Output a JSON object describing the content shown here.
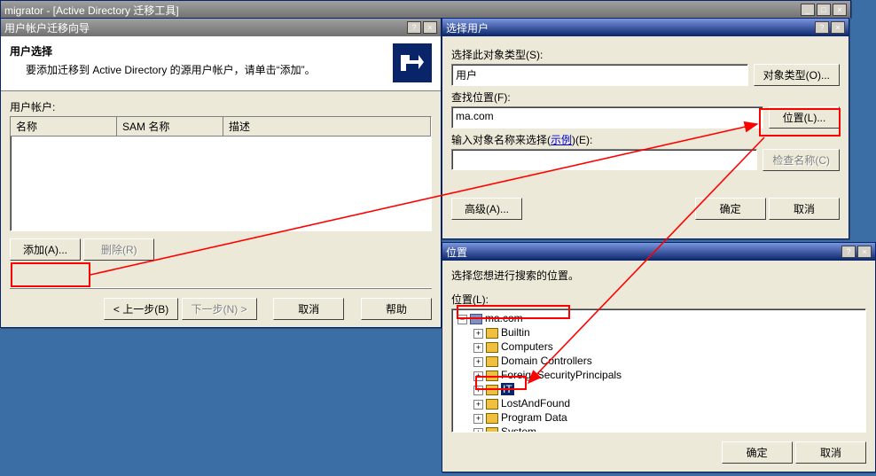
{
  "app": {
    "title": "migrator - [Active Directory 迁移工具]"
  },
  "wizard": {
    "title": "用户帐户迁移向导",
    "heading": "用户选择",
    "instruction": "要添加迁移到 Active Directory 的源用户帐户，请单击“添加”。",
    "accounts_label": "用户帐户:",
    "cols": {
      "name": "名称",
      "sam": "SAM 名称",
      "desc": "描述"
    },
    "buttons": {
      "add": "添加(A)...",
      "remove": "删除(R)",
      "back": "< 上一步(B)",
      "next": "下一步(N) >",
      "cancel": "取消",
      "help": "帮助"
    }
  },
  "select": {
    "title": "选择用户",
    "obj_type_label": "选择此对象类型(S):",
    "obj_type_value": "用户",
    "obj_type_btn": "对象类型(O)...",
    "loc_label": "查找位置(F):",
    "loc_value": "ma.com",
    "loc_btn": "位置(L)...",
    "names_label": "输入对象名称来选择(",
    "names_link": "示例",
    "names_label2": ")(E):",
    "check_btn": "检查名称(C)",
    "advanced_btn": "高级(A)...",
    "ok": "确定",
    "cancel": "取消"
  },
  "loc": {
    "title": "位置",
    "prompt": "选择您想进行搜索的位置。",
    "list_label": "位置(L):",
    "root": "ma.com",
    "nodes": [
      "Builtin",
      "Computers",
      "Domain Controllers",
      "ForeignSecurityPrincipals",
      "IT",
      "LostAndFound",
      "Program Data",
      "System"
    ],
    "selected": "IT",
    "ok": "确定",
    "cancel": "取消"
  }
}
